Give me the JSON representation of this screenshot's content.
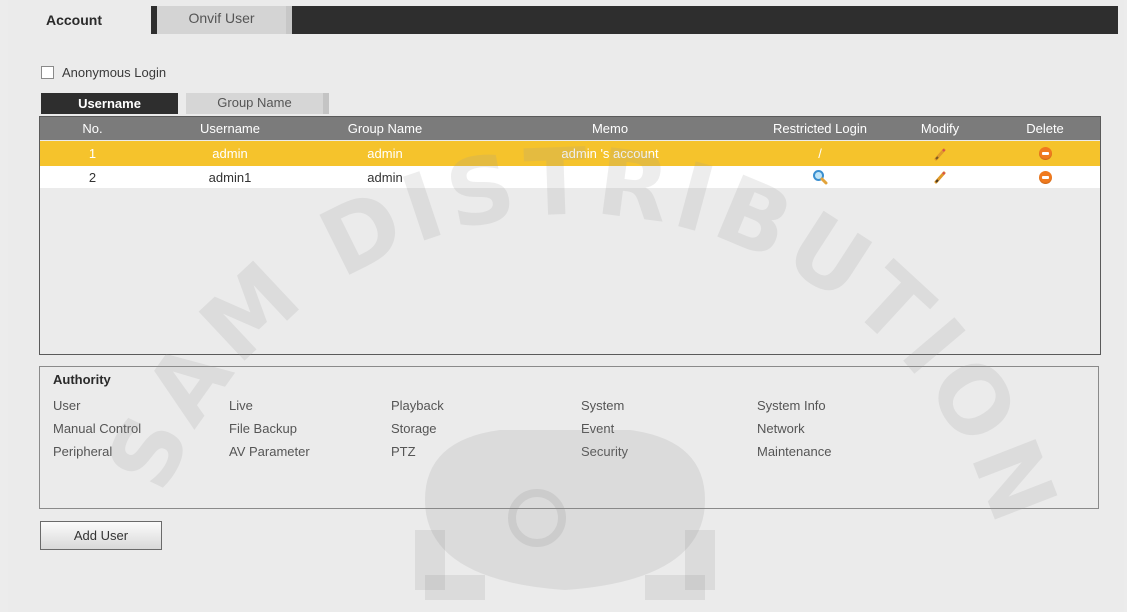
{
  "tabs": {
    "account": "Account",
    "onvif_user": "Onvif User"
  },
  "anonymous_login": {
    "label": "Anonymous Login",
    "checked": false
  },
  "subtabs": {
    "username": "Username",
    "group_name": "Group Name"
  },
  "table": {
    "headers": {
      "no": "No.",
      "username": "Username",
      "group_name": "Group Name",
      "memo": "Memo",
      "restricted_login": "Restricted Login",
      "modify": "Modify",
      "delete": "Delete"
    },
    "rows": [
      {
        "no": "1",
        "username": "admin",
        "group_name": "admin",
        "memo": "admin 's account",
        "restricted_login": "/",
        "selected": true
      },
      {
        "no": "2",
        "username": "admin1",
        "group_name": "admin",
        "memo": "",
        "restricted_login_icon": "magnifier-icon",
        "selected": false
      }
    ]
  },
  "authority": {
    "title": "Authority",
    "items": [
      [
        "User",
        "Live",
        "Playback",
        "System",
        "System Info"
      ],
      [
        "Manual Control",
        "File Backup",
        "Storage",
        "Event",
        "Network"
      ],
      [
        "Peripheral",
        "AV Parameter",
        "PTZ",
        "Security",
        "Maintenance"
      ]
    ]
  },
  "add_user_button": "Add User",
  "watermark_text": "SAM DISTRIBUTION",
  "colors": {
    "selected_row": "#f5c32c",
    "header_bg": "#7b7b7b",
    "dark_tab": "#2e2e2e",
    "delete_icon": "#f07a1e"
  }
}
